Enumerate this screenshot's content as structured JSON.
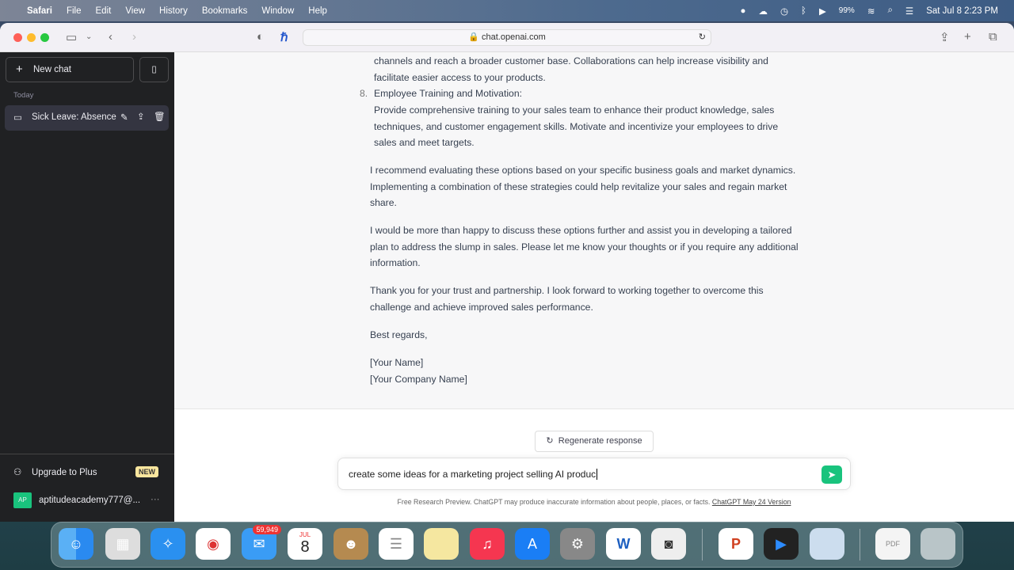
{
  "menubar": {
    "app": "Safari",
    "items": [
      "File",
      "Edit",
      "View",
      "History",
      "Bookmarks",
      "Window",
      "Help"
    ],
    "battery": "99%",
    "datetime": "Sat Jul 8  2:23 PM"
  },
  "browser": {
    "url": "chat.openai.com"
  },
  "sidebar": {
    "new_chat": "New chat",
    "section": "Today",
    "chats": [
      {
        "title": "Sick Leave: Absence"
      }
    ],
    "upgrade": "Upgrade to Plus",
    "new_badge": "NEW",
    "avatar": "AP",
    "user": "aptitudeacademy777@...",
    "more": "···"
  },
  "content": {
    "list_tail": "channels and reach a broader customer base. Collaborations can help increase visibility and facilitate easier access to your products.",
    "item8_num": "8.",
    "item8_title": "Employee Training and Motivation:",
    "item8_body": "Provide comprehensive training to your sales team to enhance their product knowledge, sales techniques, and customer engagement skills. Motivate and incentivize your employees to drive sales and meet targets.",
    "p1": "I recommend evaluating these options based on your specific business goals and market dynamics. Implementing a combination of these strategies could help revitalize your sales and regain market share.",
    "p2": "I would be more than happy to discuss these options further and assist you in developing a tailored plan to address the slump in sales. Please let me know your thoughts or if you require any additional information.",
    "p3": "Thank you for your trust and partnership. I look forward to working together to overcome this challenge and achieve improved sales performance.",
    "p4": "Best regards,",
    "p5a": "[Your Name]",
    "p5b": "[Your Company Name]"
  },
  "composer": {
    "regenerate": "Regenerate response",
    "input": "create some ideas for a marketing project selling AI produc",
    "footer": "Free Research Preview. ChatGPT may produce inaccurate information about people, places, or facts.",
    "footer_link": "ChatGPT May 24 Version"
  },
  "dock": {
    "mail_badge": "59,949",
    "cal_month": "JUL",
    "cal_day": "8"
  },
  "colors": {
    "accent": "#19c37d",
    "sidebar": "#202123"
  }
}
